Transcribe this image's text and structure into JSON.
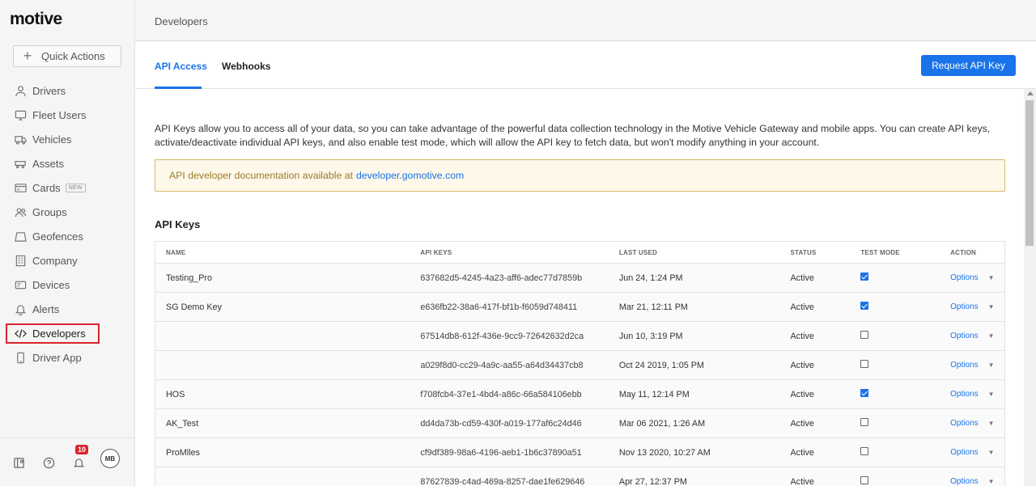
{
  "app": {
    "logo": "motive"
  },
  "sidebar": {
    "quick_actions": "Quick Actions",
    "items": [
      {
        "label": "Drivers",
        "icon": "user-icon"
      },
      {
        "label": "Fleet Users",
        "icon": "monitor-icon"
      },
      {
        "label": "Vehicles",
        "icon": "truck-icon"
      },
      {
        "label": "Assets",
        "icon": "trailer-icon"
      },
      {
        "label": "Cards",
        "icon": "card-icon",
        "badge": "NEW"
      },
      {
        "label": "Groups",
        "icon": "users-icon"
      },
      {
        "label": "Geofences",
        "icon": "geofence-icon"
      },
      {
        "label": "Company",
        "icon": "building-icon"
      },
      {
        "label": "Devices",
        "icon": "device-icon"
      },
      {
        "label": "Alerts",
        "icon": "bell-icon"
      },
      {
        "label": "Developers",
        "icon": "code-icon",
        "active": true
      },
      {
        "label": "Driver App",
        "icon": "phone-icon"
      }
    ],
    "footer": {
      "notifications_count": "10",
      "avatar_initials": "MB"
    }
  },
  "header": {
    "title": "Developers"
  },
  "tabs": [
    {
      "label": "API Access",
      "active": true
    },
    {
      "label": "Webhooks",
      "active": false
    }
  ],
  "request_button": "Request API Key",
  "intro": "API Keys allow you to access all of your data, so you can take advantage of the powerful data collection technology in the Motive Vehicle Gateway and mobile apps. You can create API keys, activate/deactivate individual API keys, and also enable test mode, which will allow the API key to fetch data, but won't modify anything in your account.",
  "doc_note": {
    "text": "API developer documentation available at",
    "link": "developer.gomotive.com"
  },
  "section_title": "API Keys",
  "table": {
    "columns": [
      "NAME",
      "API KEYS",
      "LAST USED",
      "STATUS",
      "TEST MODE",
      "ACTION"
    ],
    "rows": [
      {
        "name": "Testing_Pro",
        "key": "637682d5-4245-4a23-aff6-adec77d7859b",
        "last_used": "Jun 24, 1:24 PM",
        "status": "Active",
        "test_mode": true,
        "action": "Options"
      },
      {
        "name": "SG Demo Key",
        "key": "e636fb22-38a6-417f-bf1b-f6059d748411",
        "last_used": "Mar 21, 12:11 PM",
        "status": "Active",
        "test_mode": true,
        "action": "Options"
      },
      {
        "name": "",
        "key": "67514db8-612f-436e-9cc9-72642632d2ca",
        "last_used": "Jun 10, 3:19 PM",
        "status": "Active",
        "test_mode": false,
        "action": "Options"
      },
      {
        "name": "",
        "key": "a029f8d0-cc29-4a9c-aa55-a64d34437cb8",
        "last_used": "Oct 24 2019, 1:05 PM",
        "status": "Active",
        "test_mode": false,
        "action": "Options"
      },
      {
        "name": "HOS",
        "key": "f708fcb4-37e1-4bd4-a86c-66a584106ebb",
        "last_used": "May 11, 12:14 PM",
        "status": "Active",
        "test_mode": true,
        "action": "Options"
      },
      {
        "name": "AK_Test",
        "key": "dd4da73b-cd59-430f-a019-177af6c24d46",
        "last_used": "Mar 06 2021, 1:26 AM",
        "status": "Active",
        "test_mode": false,
        "action": "Options"
      },
      {
        "name": "ProMlles",
        "key": "cf9df389-98a6-4196-aeb1-1b6c37890a51",
        "last_used": "Nov 13 2020, 10:27 AM",
        "status": "Active",
        "test_mode": false,
        "action": "Options"
      },
      {
        "name": "",
        "key": "87627839-c4ad-469a-8257-dae1fe629646",
        "last_used": "Apr 27, 12:37 PM",
        "status": "Active",
        "test_mode": false,
        "action": "Options"
      }
    ]
  }
}
